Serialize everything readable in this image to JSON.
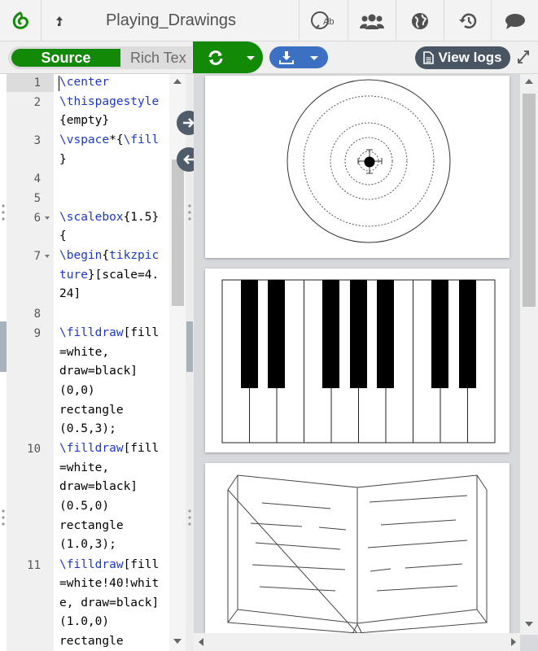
{
  "header": {
    "logo_icon": "overleaf-logo-icon",
    "upload_icon": "upload-arrow-icon",
    "project_title": "Playing_Drawings",
    "actions": [
      "spellcheck-icon",
      "users-icon",
      "globe-icon",
      "history-icon",
      "chat-icon"
    ]
  },
  "toolbar": {
    "source_label": "Source",
    "rich_text_label": "Rich Tex",
    "recompile_icon": "refresh-icon",
    "download_icon": "download-icon",
    "view_logs_label": "View logs",
    "expand_icon": "expand-icon"
  },
  "editor": {
    "line_numbers": [
      "1",
      "2",
      "3",
      "4",
      "5",
      "6",
      "7",
      "8",
      "9",
      "10",
      "11"
    ],
    "code_rows": [
      {
        "cmd": "\\center",
        "rest": ""
      },
      {
        "cmd": "\\thispagestyle",
        "rest": ""
      },
      {
        "cmd": "",
        "rest": "{empty}"
      },
      {
        "cmd": "\\vspace",
        "rest": "*{",
        "cmd2": "\\fill"
      },
      {
        "cmd": "",
        "rest": "}"
      },
      {
        "cmd": "\\scalebox",
        "rest": "{1.5}"
      },
      {
        "cmd": "",
        "rest": "{"
      },
      {
        "cmd": "\\begin",
        "rest": "{",
        "cmd2": "tikzpic"
      },
      {
        "cmd": "ture",
        "rest": "}[scale=4."
      },
      {
        "cmd": "",
        "rest": "24]"
      },
      {
        "cmd": "\\filldraw",
        "rest": "[fill"
      },
      {
        "cmd": "",
        "rest": "=white,"
      },
      {
        "cmd": "",
        "rest": "draw=black]"
      },
      {
        "cmd": "",
        "rest": "(0,0)"
      },
      {
        "cmd": "",
        "rest": "rectangle"
      },
      {
        "cmd": "",
        "rest": "(0.5,3);"
      },
      {
        "cmd": "\\filldraw",
        "rest": "[fill"
      },
      {
        "cmd": "",
        "rest": "=white,"
      },
      {
        "cmd": "",
        "rest": "draw=black]"
      },
      {
        "cmd": "",
        "rest": "(0.5,0)"
      },
      {
        "cmd": "",
        "rest": "rectangle"
      },
      {
        "cmd": "",
        "rest": "(1.0,3);"
      },
      {
        "cmd": "\\filldraw",
        "rest": "[fill"
      },
      {
        "cmd": "",
        "rest": "=white!40!whit"
      },
      {
        "cmd": "",
        "rest": "e, draw=black]"
      },
      {
        "cmd": "",
        "rest": "(1.0,0)"
      },
      {
        "cmd": "",
        "rest": "rectangle"
      }
    ]
  },
  "preview": {
    "pages": [
      "target-drawing",
      "piano-keyboard-drawing",
      "open-book-drawing"
    ]
  },
  "colors": {
    "green": "#138a07",
    "blue": "#3c70c2",
    "dark": "#4a5563",
    "command": "#1d38c7"
  }
}
